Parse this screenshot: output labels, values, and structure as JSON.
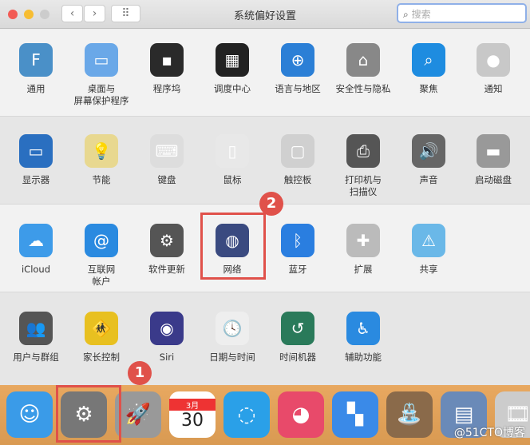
{
  "window": {
    "title": "系统偏好设置",
    "search_placeholder": "搜索",
    "back": "‹",
    "forward": "›",
    "grid": "⠿"
  },
  "rows": [
    [
      {
        "label": "通用",
        "icon": "general-icon",
        "color": "#4a90c8",
        "glyph": "F"
      },
      {
        "label": "桌面与\n屏幕保护程序",
        "icon": "desktop-screensaver-icon",
        "color": "#6aa8e8",
        "glyph": "▭"
      },
      {
        "label": "程序坞",
        "icon": "dock-icon",
        "color": "#2a2a2a",
        "glyph": "▪"
      },
      {
        "label": "调度中心",
        "icon": "mission-control-icon",
        "color": "#222",
        "glyph": "▦"
      },
      {
        "label": "语言与地区",
        "icon": "language-region-icon",
        "color": "#2b7fd6",
        "glyph": "⊕"
      },
      {
        "label": "安全性与隐私",
        "icon": "security-privacy-icon",
        "color": "#888",
        "glyph": "⌂"
      },
      {
        "label": "聚焦",
        "icon": "spotlight-icon",
        "color": "#1e8ce0",
        "glyph": "⌕"
      },
      {
        "label": "通知",
        "icon": "notifications-icon",
        "color": "#c8c8c8",
        "glyph": "●"
      }
    ],
    [
      {
        "label": "显示器",
        "icon": "displays-icon",
        "color": "#2a6fc0",
        "glyph": "▭"
      },
      {
        "label": "节能",
        "icon": "energy-saver-icon",
        "color": "#e8d890",
        "glyph": "💡"
      },
      {
        "label": "键盘",
        "icon": "keyboard-icon",
        "color": "#ddd",
        "glyph": "⌨"
      },
      {
        "label": "鼠标",
        "icon": "mouse-icon",
        "color": "#e8e8e8",
        "glyph": "▯"
      },
      {
        "label": "触控板",
        "icon": "trackpad-icon",
        "color": "#d0d0d0",
        "glyph": "▢"
      },
      {
        "label": "打印机与\n扫描仪",
        "icon": "printers-scanners-icon",
        "color": "#555",
        "glyph": "⎙"
      },
      {
        "label": "声音",
        "icon": "sound-icon",
        "color": "#666",
        "glyph": "🔊"
      },
      {
        "label": "启动磁盘",
        "icon": "startup-disk-icon",
        "color": "#999",
        "glyph": "▬"
      }
    ],
    [
      {
        "label": "iCloud",
        "icon": "icloud-icon",
        "color": "#3d9be9",
        "glyph": "☁"
      },
      {
        "label": "互联网\n帐户",
        "icon": "internet-accounts-icon",
        "color": "#2a8ae0",
        "glyph": "@"
      },
      {
        "label": "软件更新",
        "icon": "software-update-icon",
        "color": "#555",
        "glyph": "⚙"
      },
      {
        "label": "网络",
        "icon": "network-icon",
        "color": "#3a4a80",
        "glyph": "◍"
      },
      {
        "label": "蓝牙",
        "icon": "bluetooth-icon",
        "color": "#2a7ee0",
        "glyph": "ᛒ"
      },
      {
        "label": "扩展",
        "icon": "extensions-icon",
        "color": "#bbb",
        "glyph": "✚"
      },
      {
        "label": "共享",
        "icon": "sharing-icon",
        "color": "#6ab8e8",
        "glyph": "⚠"
      }
    ],
    [
      {
        "label": "用户与群组",
        "icon": "users-groups-icon",
        "color": "#555",
        "glyph": "👥"
      },
      {
        "label": "家长控制",
        "icon": "parental-controls-icon",
        "color": "#e8c020",
        "glyph": "🚸"
      },
      {
        "label": "Siri",
        "icon": "siri-icon",
        "color": "#3a3a8a",
        "glyph": "◉"
      },
      {
        "label": "日期与时间",
        "icon": "date-time-icon",
        "color": "#eee",
        "glyph": "🕓"
      },
      {
        "label": "时间机器",
        "icon": "time-machine-icon",
        "color": "#2a7a5a",
        "glyph": "↺"
      },
      {
        "label": "辅助功能",
        "icon": "accessibility-icon",
        "color": "#2a8ae0",
        "glyph": "♿"
      }
    ]
  ],
  "dock": [
    {
      "name": "finder-icon",
      "color": "#3a9be8",
      "glyph": "☺"
    },
    {
      "name": "system-preferences-icon",
      "color": "#777",
      "glyph": "⚙"
    },
    {
      "name": "launchpad-icon",
      "color": "#999",
      "glyph": "🚀"
    },
    {
      "name": "calendar-icon",
      "color": "#fff",
      "glyph": "30",
      "month": "3月"
    },
    {
      "name": "wecom-icon",
      "color": "#2aa0e8",
      "glyph": "◌"
    },
    {
      "name": "browser-icon",
      "color": "#e84a6a",
      "glyph": "◕"
    },
    {
      "name": "app-icon",
      "color": "#3a8ae8",
      "glyph": "▚"
    },
    {
      "name": "photo-well-icon",
      "color": "#8a6a4a",
      "glyph": "⛲"
    },
    {
      "name": "file-server-icon",
      "color": "#6a8ab8",
      "glyph": "▤"
    },
    {
      "name": "video-icon",
      "color": "#ccc",
      "glyph": "🎞"
    }
  ],
  "annotations": {
    "step1": "1",
    "step2": "2"
  },
  "watermark": "@51CTO博客"
}
